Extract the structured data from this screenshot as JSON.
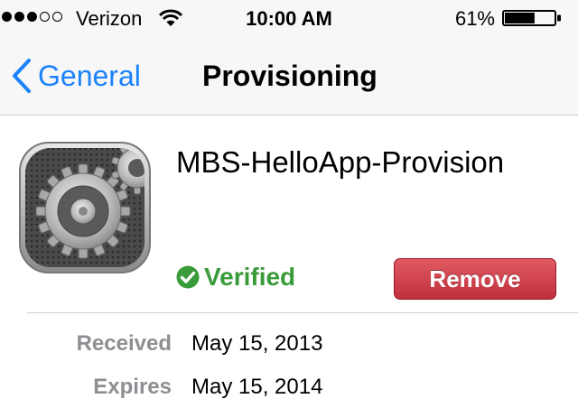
{
  "status_bar": {
    "signal_icon": "signal-strength-dots",
    "signal_strength": 3,
    "signal_max": 5,
    "carrier": "Verizon",
    "wifi_icon": "wifi-icon",
    "time": "10:00 AM",
    "battery_percent": "61%",
    "battery_level": 0.61
  },
  "nav": {
    "back_label": "General",
    "title": "Provisioning"
  },
  "profile": {
    "icon": "settings-gear-icon",
    "name": "MBS-HelloApp-Provision",
    "status": "Verified",
    "remove_label": "Remove"
  },
  "details": [
    {
      "label": "Received",
      "value": "May 15, 2013"
    },
    {
      "label": "Expires",
      "value": "May 15, 2014"
    }
  ],
  "colors": {
    "accent": "#1a82fb",
    "verified": "#3a9b3a",
    "remove": "#c0303b"
  }
}
